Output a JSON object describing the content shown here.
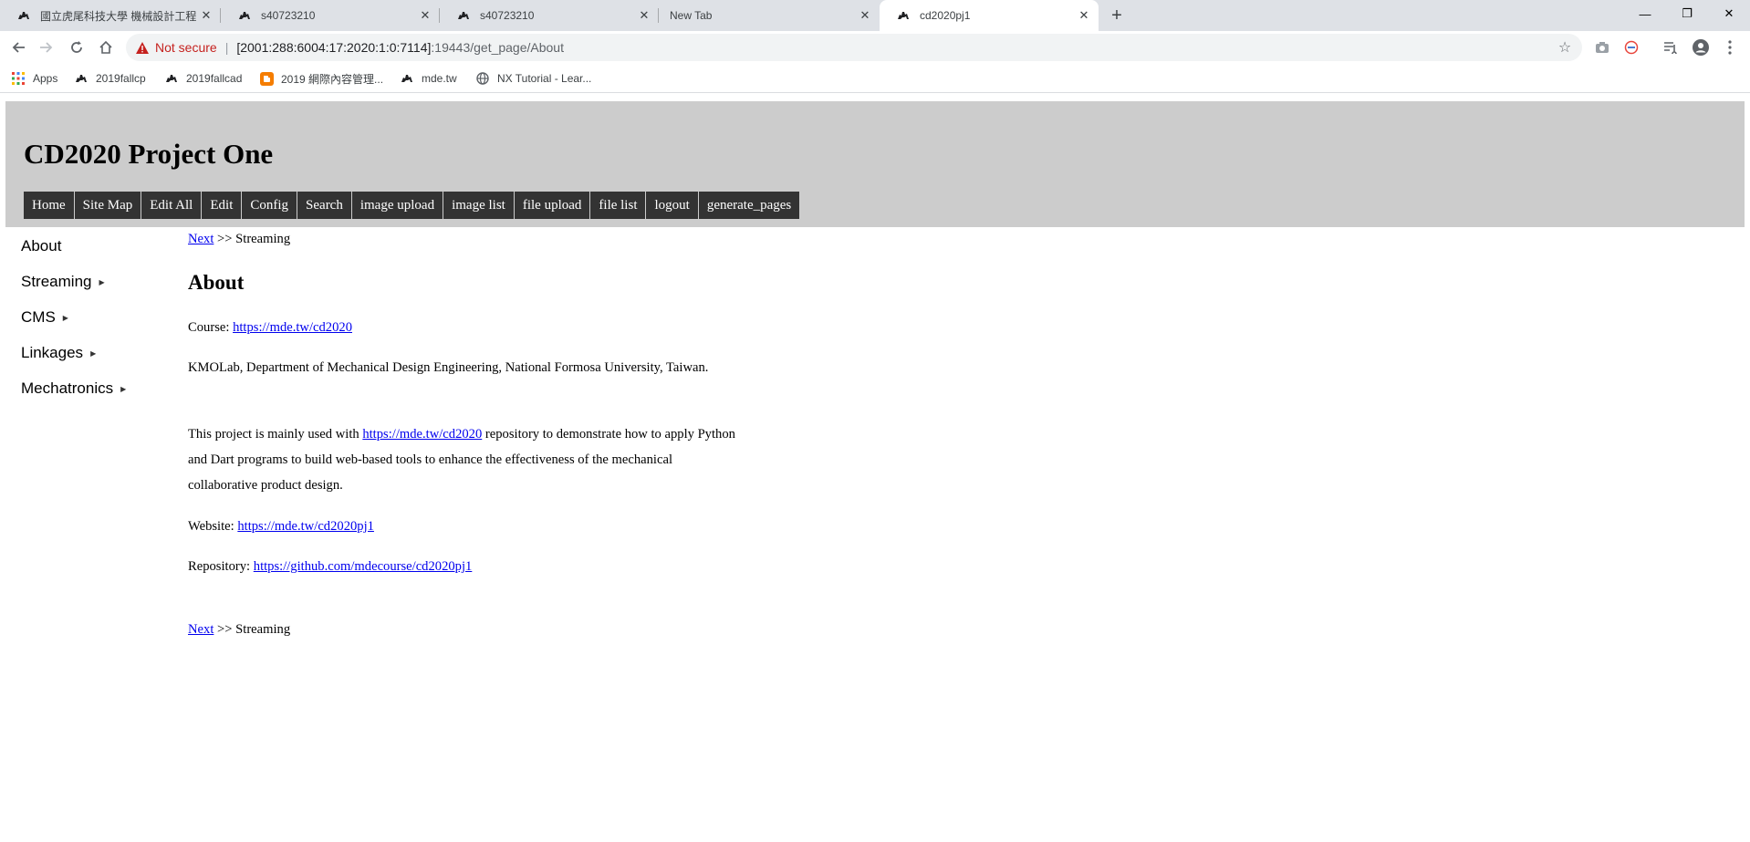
{
  "browser": {
    "tabs": [
      {
        "title": "國立虎尾科技大學 機械設計工程",
        "active": false,
        "close": "✕"
      },
      {
        "title": "s40723210",
        "active": false,
        "close": "✕"
      },
      {
        "title": "s40723210",
        "active": false,
        "close": "✕"
      },
      {
        "title": "New Tab",
        "active": false,
        "close": "✕"
      },
      {
        "title": "cd2020pj1",
        "active": true,
        "close": "✕"
      }
    ],
    "new_tab": "+",
    "window_controls": {
      "minimize": "—",
      "restore": "❐",
      "close": "✕"
    },
    "security_label": "Not secure",
    "url_host": "[2001:288:6004:17:2020:1:0:7114]",
    "url_path": ":19443/get_page/About",
    "bookmarks": [
      {
        "label": "Apps",
        "icon": "apps-grid-icon"
      },
      {
        "label": "2019fallcp",
        "icon": "camel-icon"
      },
      {
        "label": "2019fallcad",
        "icon": "camel-icon"
      },
      {
        "label": "2019 網際內容管理...",
        "icon": "blogger-icon"
      },
      {
        "label": "mde.tw",
        "icon": "camel-icon"
      },
      {
        "label": "NX Tutorial - Lear...",
        "icon": "globe-icon"
      }
    ],
    "accent_color": "#c5221f"
  },
  "site": {
    "title": "CD2020 Project One",
    "menu": [
      {
        "label": "Home"
      },
      {
        "label": "Site Map"
      },
      {
        "label": "Edit All"
      },
      {
        "label": "Edit"
      },
      {
        "label": "Config"
      },
      {
        "label": "Search"
      },
      {
        "label": "image upload"
      },
      {
        "label": "image list"
      },
      {
        "label": "file upload"
      },
      {
        "label": "file list"
      },
      {
        "label": "logout"
      },
      {
        "label": "generate_pages"
      }
    ],
    "sidebar": [
      {
        "label": "About",
        "has_children": false
      },
      {
        "label": "Streaming",
        "has_children": true
      },
      {
        "label": "CMS",
        "has_children": true
      },
      {
        "label": "Linkages",
        "has_children": true
      },
      {
        "label": "Mechatronics",
        "has_children": true
      }
    ]
  },
  "page": {
    "nav_link": "Next",
    "nav_separator": ">>",
    "nav_target": "Streaming",
    "heading": "About",
    "course_label": "Course:",
    "course_link": "https://mde.tw/cd2020",
    "affiliation": "KMOLab, Department of Mechanical Design Engineering, National Formosa University, Taiwan.",
    "desc_before": "This project is mainly used with",
    "desc_link": "https://mde.tw/cd2020",
    "desc_after": "repository to demonstrate how to apply Python and Dart programs to build web-based tools to enhance the effectiveness of the mechanical collaborative product design.",
    "website_label": "Website:",
    "website_link": "https://mde.tw/cd2020pj1",
    "repo_label": "Repository:",
    "repo_link": "https://github.com/mdecourse/cd2020pj1"
  }
}
